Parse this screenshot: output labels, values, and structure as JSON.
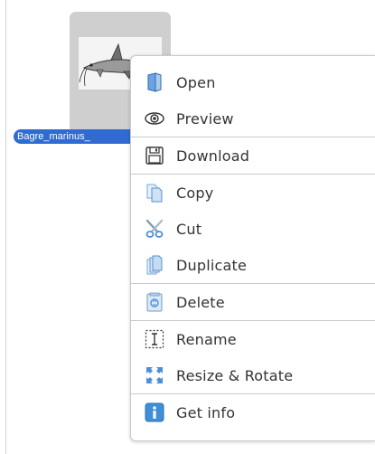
{
  "file": {
    "name": "Bagre_marinus_"
  },
  "menu": {
    "items": [
      {
        "label": "Open",
        "icon": "open-folder-icon"
      },
      {
        "label": "Preview",
        "icon": "eye-icon"
      },
      {
        "label": "Download",
        "icon": "floppy-disk-icon"
      },
      {
        "label": "Copy",
        "icon": "copy-icon"
      },
      {
        "label": "Cut",
        "icon": "scissors-icon"
      },
      {
        "label": "Duplicate",
        "icon": "duplicate-icon"
      },
      {
        "label": "Delete",
        "icon": "trash-icon"
      },
      {
        "label": "Rename",
        "icon": "rename-cursor-icon"
      },
      {
        "label": "Resize & Rotate",
        "icon": "resize-arrows-icon"
      },
      {
        "label": "Get info",
        "icon": "info-icon"
      }
    ]
  },
  "colors": {
    "selection": "#2f6bd2",
    "icon_blue": "#4a90d9",
    "menu_border": "#c9c9c9"
  }
}
